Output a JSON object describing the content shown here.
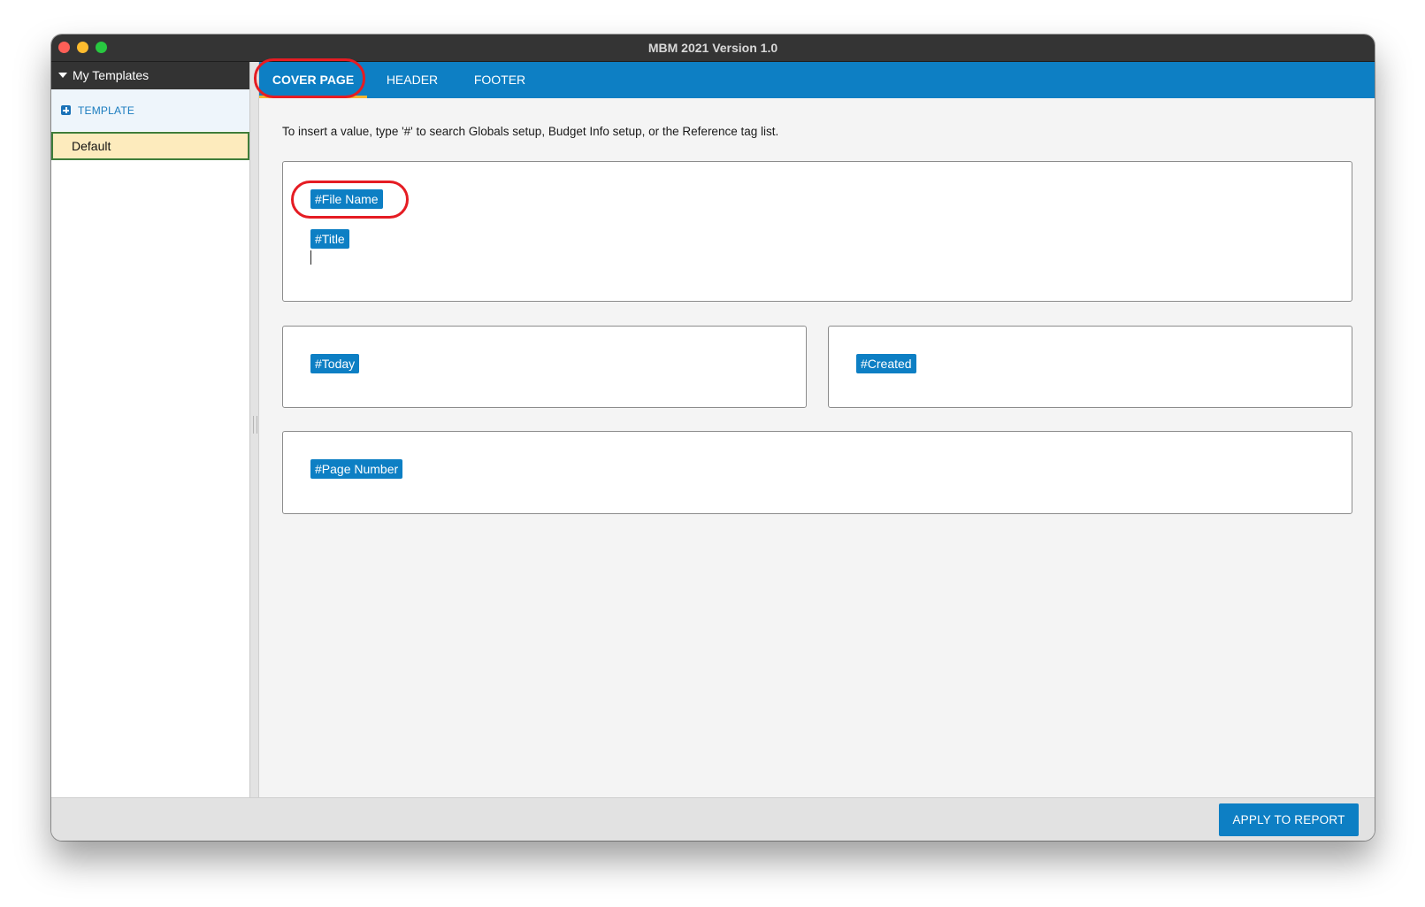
{
  "window": {
    "title": "MBM 2021 Version 1.0"
  },
  "sidebar": {
    "header": "My Templates",
    "add_label": "TEMPLATE",
    "items": [
      {
        "label": "Default",
        "selected": true
      }
    ]
  },
  "tabs": [
    {
      "label": "COVER PAGE",
      "active": true
    },
    {
      "label": "HEADER",
      "active": false
    },
    {
      "label": "FOOTER",
      "active": false
    }
  ],
  "main": {
    "instruction": "To insert a value, type '#' to search Globals setup, Budget Info setup, or the Reference tag list.",
    "sections": [
      {
        "name": "title-section",
        "tags": [
          "#File Name",
          "#Title"
        ]
      },
      {
        "name": "left-section",
        "tags": [
          "#Today"
        ]
      },
      {
        "name": "right-section",
        "tags": [
          "#Created"
        ]
      },
      {
        "name": "bottom-section",
        "tags": [
          "#Page Number"
        ]
      }
    ]
  },
  "footer": {
    "apply_label": "APPLY TO REPORT"
  },
  "colors": {
    "accent": "#0d7fc4",
    "tab_underline": "#f4b631",
    "selection_bg": "#fdebbd",
    "selection_border": "#3f7d3a",
    "annotation_ring": "#e51c23"
  },
  "icons": [
    "disclosure-triangle-icon",
    "plus-square-icon"
  ]
}
